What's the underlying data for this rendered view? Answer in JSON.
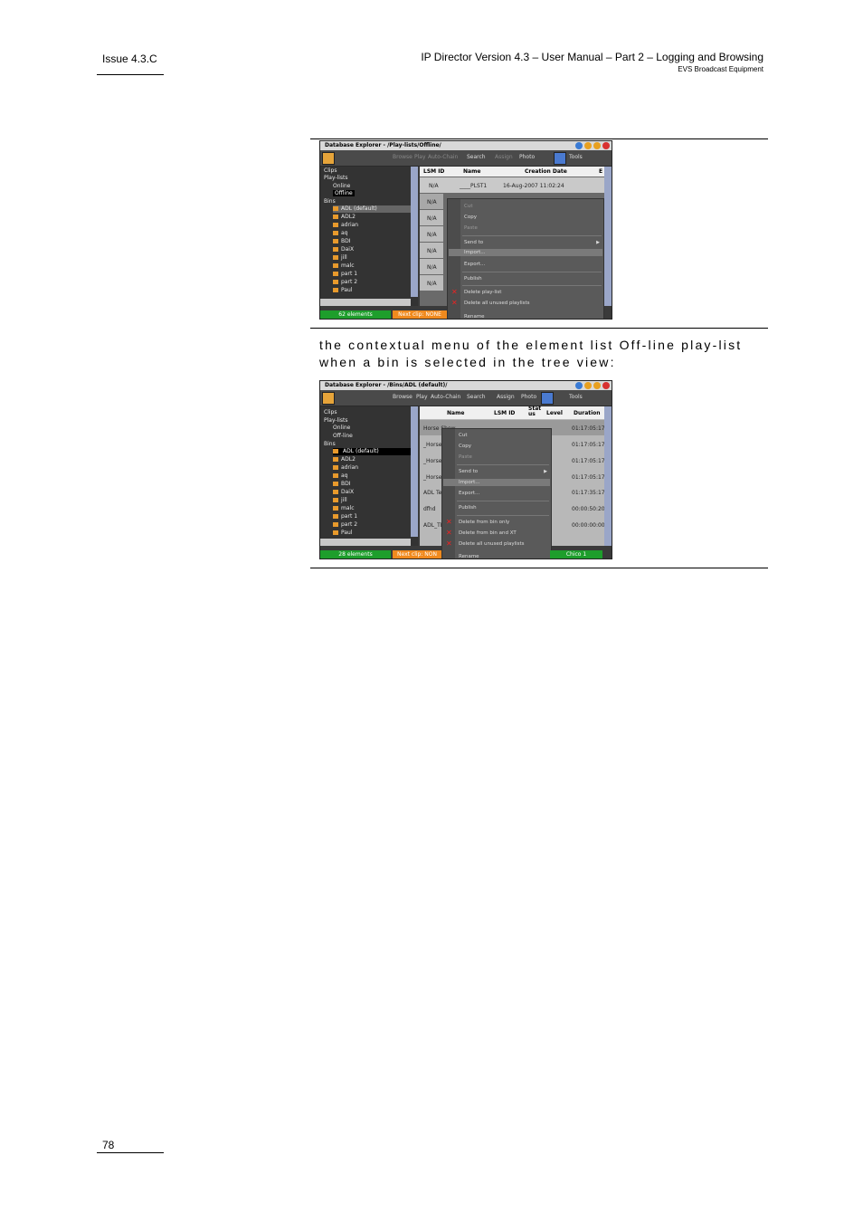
{
  "header": {
    "issue": "Issue 4.3.C",
    "title": "IP Director Version 4.3 – User Manual – Part 2 – Logging and Browsing",
    "subtitle": "EVS Broadcast Equipment"
  },
  "paragraph": {
    "line1": "the contextual menu of the element list  Off-line play-list",
    "line2": "when a bin is selected in the tree view:"
  },
  "footer": {
    "page_number": "78"
  },
  "shot1": {
    "title": "Database Explorer - /Play-lists/Offline/",
    "toolbar": [
      "Browse",
      "Play",
      "Auto-Chain",
      "Search",
      "Assign",
      "Photo",
      "Tools"
    ],
    "tree": {
      "clips": "Clips",
      "playlists": "Play-lists",
      "online": "Online",
      "offline": "Offline",
      "bins": "Bins",
      "bin_items": [
        "ADL (default)",
        "ADL2",
        "adrian",
        "aq",
        "BDI",
        "DaiX",
        "jill",
        "malc",
        "part 1",
        "part 2",
        "Paul"
      ]
    },
    "columns": [
      "LSM ID",
      "Name",
      "Creation Date",
      "E"
    ],
    "first_row": {
      "lsm": "N/A",
      "name": "____PLST1",
      "date": "16-Aug-2007 11:02:24"
    },
    "rows_lsm": [
      "N/A",
      "N/A",
      "N/A",
      "N/A",
      "N/A",
      "N/A"
    ],
    "menu": [
      "Cut",
      "Copy",
      "Paste",
      "Send to",
      "Import...",
      "Export...",
      "Publish",
      "Delete play-list",
      "Delete all unused playlists",
      "Rename"
    ],
    "status_left": "62 elements",
    "status_mid": "Next clip: NONE"
  },
  "shot2": {
    "title": "Database Explorer - /Bins/ADL (default)/",
    "toolbar": [
      "Browse",
      "Play",
      "Auto-Chain",
      "Search",
      "Assign",
      "Photo",
      "Tools"
    ],
    "tree": {
      "clips": "Clips",
      "playlists": "Play-lists",
      "online": "Online",
      "offline": "Off-line",
      "bins": "Bins",
      "bin_items": [
        "ADL (default)",
        "ADL2",
        "adrian",
        "aq",
        "BDI",
        "DaiX",
        "jill",
        "malc",
        "part 1",
        "part 2",
        "Paul"
      ]
    },
    "columns": [
      "Name",
      "LSM ID",
      "Stat us",
      "Level",
      "Duration"
    ],
    "row_names": [
      "Horse Show",
      "_Horse",
      "_Horse",
      "_Horse",
      "ADL Te",
      "dfhd",
      "ADL_TE"
    ],
    "durations": [
      "01:17:05:17",
      "01:17:05:17",
      "01:17:05:17",
      "01:17:05:17",
      "01:17:35:17",
      "00:00:50:20",
      "00:00:00:00"
    ],
    "menu": [
      "Cut",
      "Copy",
      "Paste",
      "Send to",
      "Import...",
      "Export...",
      "Publish",
      "Delete from bin only",
      "Delete from bin and XT",
      "Delete all unused playlists",
      "Rename"
    ],
    "status_left": "28 elements",
    "status_mid": "Next clip: NON",
    "status_right": "Chico 1"
  }
}
